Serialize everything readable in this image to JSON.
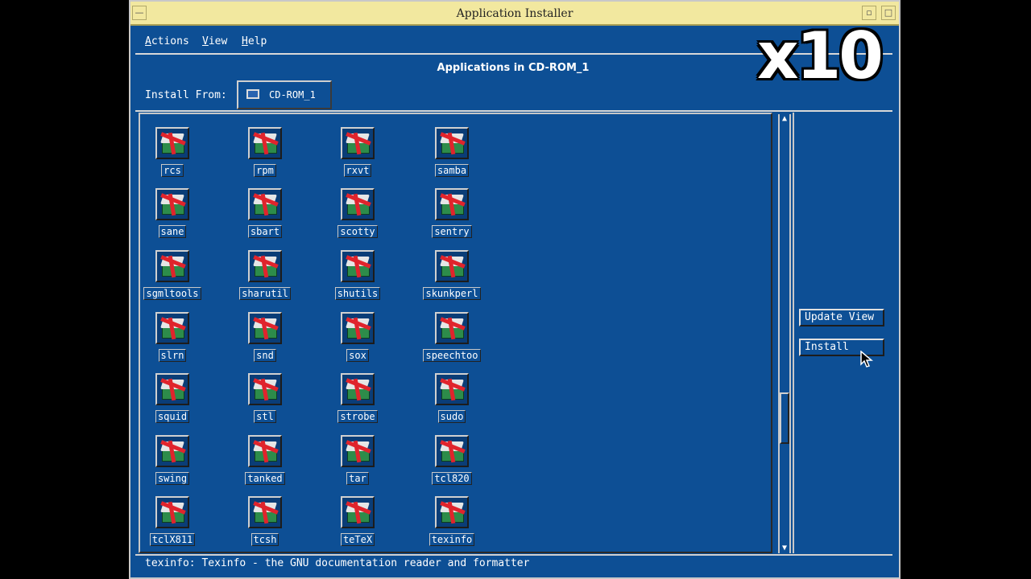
{
  "window": {
    "title": "Application Installer"
  },
  "menu": [
    {
      "label": "Actions",
      "mnemonic": "A",
      "rest": "ctions"
    },
    {
      "label": "View",
      "mnemonic": "V",
      "rest": "iew"
    },
    {
      "label": "Help",
      "mnemonic": "H",
      "rest": "elp"
    }
  ],
  "heading": "Applications in CD-ROM_1",
  "install_from": {
    "label": "Install From:",
    "source": "CD-ROM_1"
  },
  "apps": [
    "rcs",
    "rpm",
    "rxvt",
    "samba",
    "sane",
    "sbart",
    "scotty",
    "sentry",
    "sgmltools",
    "sharutil",
    "shutils",
    "skunkperl",
    "slrn",
    "snd",
    "sox",
    "speechtoo",
    "squid",
    "stl",
    "strobe",
    "sudo",
    "swing",
    "tanked",
    "tar",
    "tcl820",
    "tclX811",
    "tcsh",
    "teTeX",
    "texinfo"
  ],
  "buttons": {
    "update_view": "Update View",
    "install": "Install"
  },
  "status": "texinfo: Texinfo - the GNU documentation reader and formatter",
  "overlay": {
    "speed": "x10"
  },
  "icons": {
    "app_icon": "package-icon",
    "source_icon": "cdrom-icon"
  },
  "colors": {
    "window_bg": "#0d4f95",
    "titlebar_bg": "#f2e89f",
    "ribbon": "#e0242c",
    "package": "#2d8c4a"
  }
}
